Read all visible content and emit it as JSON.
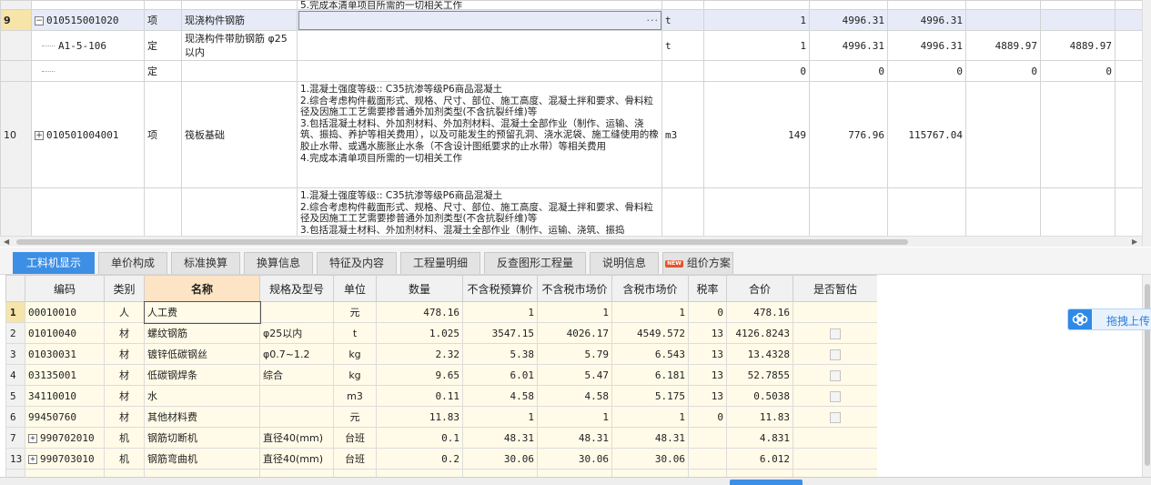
{
  "upper": {
    "top_text": "5.完成本清单项目所需的一切相关工作",
    "rows": [
      {
        "no": "9",
        "code": "010515001020",
        "type": "项",
        "name": "现浇构件钢筋",
        "desc": "",
        "ellipsis": "···",
        "unit": "t",
        "qty": "1",
        "price": "4996.31",
        "total": "4996.31",
        "c10": "",
        "c11": ""
      },
      {
        "no": "",
        "code": "A1-5-106",
        "type": "定",
        "name": "现浇构件带肋钢筋 φ25以内",
        "desc": "",
        "unit": "t",
        "qty": "1",
        "price": "4996.31",
        "total": "4996.31",
        "c10": "4889.97",
        "c11": "4889.97"
      },
      {
        "no": "",
        "code": "",
        "type": "定",
        "name": "",
        "desc": "",
        "unit": "",
        "qty": "0",
        "price": "0",
        "total": "0",
        "c10": "0",
        "c11": "0"
      },
      {
        "no": "10",
        "code": "010501004001",
        "type": "项",
        "name": "筏板基础",
        "desc": [
          "1.混凝土强度等级:: C35抗渗等级P6商品混凝土",
          "2.综合考虑构件截面形式、规格、尺寸、部位、施工高度、混凝土拌和要求、骨料粒径及因施工工艺需要掺普通外加剂类型(不含抗裂纤维)等",
          "3.包括混凝土材料、外加剂材料、外加剂材料、混凝土全部作业（制作、运输、浇筑、振捣、养护等相关费用），以及可能发生的预留孔洞、浇水泥袋、施工缝使用的橡胶止水带、或遇水膨胀止水条（不含设计图纸要求的止水带）等相关费用",
          "4.完成本清单项目所需的一切相关工作"
        ],
        "unit": "m3",
        "qty": "149",
        "price": "776.96",
        "total": "115767.04",
        "c10": "",
        "c11": ""
      },
      {
        "no": "",
        "code": "",
        "type": "",
        "name": "",
        "desc": [
          "1.混凝土强度等级:: C35抗渗等级P6商品混凝土",
          "2.综合考虑构件截面形式、规格、尺寸、部位、施工高度、混凝土拌和要求、骨料粒径及因施工工艺需要掺普通外加剂类型(不含抗裂纤维)等",
          "3.包括混凝土材料、外加剂材料、混凝土全部作业（制作、运输、浇筑、振捣"
        ],
        "unit": "",
        "qty": "",
        "price": "",
        "total": "",
        "c10": "",
        "c11": ""
      }
    ]
  },
  "tabs": [
    {
      "label": "工料机显示",
      "active": true
    },
    {
      "label": "单价构成"
    },
    {
      "label": "标准换算"
    },
    {
      "label": "换算信息"
    },
    {
      "label": "特征及内容"
    },
    {
      "label": "工程量明细"
    },
    {
      "label": "反查图形工程量"
    },
    {
      "label": "说明信息"
    },
    {
      "label": "组价方案",
      "badge": "NEW"
    }
  ],
  "lower": {
    "headers": [
      "",
      "编码",
      "类别",
      "名称",
      "规格及型号",
      "单位",
      "数量",
      "不含税预算价",
      "不含税市场价",
      "含税市场价",
      "税率",
      "合价",
      "是否暂估"
    ],
    "rows": [
      {
        "rn": "1",
        "code": "00010010",
        "cat": "人",
        "name": "人工费",
        "spec": "",
        "unit": "元",
        "qty": "478.16",
        "budget": "1",
        "market": "1",
        "tax_market": "1",
        "rate": "0",
        "total": "478.16",
        "check": false,
        "expand": false
      },
      {
        "rn": "2",
        "code": "01010040",
        "cat": "材",
        "name": "螺纹钢筋",
        "spec": "φ25以内",
        "unit": "t",
        "qty": "1.025",
        "budget": "3547.15",
        "market": "4026.17",
        "tax_market": "4549.572",
        "rate": "13",
        "total": "4126.8243",
        "check": true,
        "expand": false
      },
      {
        "rn": "3",
        "code": "01030031",
        "cat": "材",
        "name": "镀锌低碳钢丝",
        "spec": "φ0.7~1.2",
        "unit": "kg",
        "qty": "2.32",
        "budget": "5.38",
        "market": "5.79",
        "tax_market": "6.543",
        "rate": "13",
        "total": "13.4328",
        "check": true,
        "expand": false
      },
      {
        "rn": "4",
        "code": "03135001",
        "cat": "材",
        "name": "低碳钢焊条",
        "spec": "综合",
        "unit": "kg",
        "qty": "9.65",
        "budget": "6.01",
        "market": "5.47",
        "tax_market": "6.181",
        "rate": "13",
        "total": "52.7855",
        "check": true,
        "expand": false
      },
      {
        "rn": "5",
        "code": "34110010",
        "cat": "材",
        "name": "水",
        "spec": "",
        "unit": "m3",
        "qty": "0.11",
        "budget": "4.58",
        "market": "4.58",
        "tax_market": "5.175",
        "rate": "13",
        "total": "0.5038",
        "check": true,
        "expand": false
      },
      {
        "rn": "6",
        "code": "99450760",
        "cat": "材",
        "name": "其他材料费",
        "spec": "",
        "unit": "元",
        "qty": "11.83",
        "budget": "1",
        "market": "1",
        "tax_market": "1",
        "rate": "0",
        "total": "11.83",
        "check": true,
        "expand": false
      },
      {
        "rn": "7",
        "code": "990702010",
        "cat": "机",
        "name": "钢筋切断机",
        "spec": "直径40(mm)",
        "unit": "台班",
        "qty": "0.1",
        "budget": "48.31",
        "market": "48.31",
        "tax_market": "48.31",
        "rate": "",
        "total": "4.831",
        "check": false,
        "expand": true
      },
      {
        "rn": "13",
        "code": "990703010",
        "cat": "机",
        "name": "钢筋弯曲机",
        "spec": "直径40(mm)",
        "unit": "台班",
        "qty": "0.2",
        "budget": "30.06",
        "market": "30.06",
        "tax_market": "30.06",
        "rate": "",
        "total": "6.012",
        "check": false,
        "expand": true
      }
    ]
  },
  "upload": {
    "label": "拖拽上传"
  }
}
